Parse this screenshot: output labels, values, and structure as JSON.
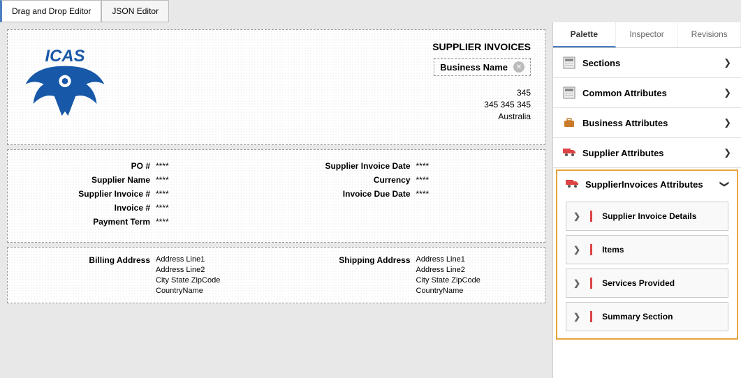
{
  "tabs": {
    "dragdrop": "Drag and Drop Editor",
    "json": "JSON Editor"
  },
  "header": {
    "title": "SUPPLIER INVOICES",
    "businessName": "Business Name",
    "addr": {
      "l1": "345",
      "l2": "345  345  345",
      "l3": "Australia"
    }
  },
  "details": {
    "left": [
      {
        "label": "PO #",
        "val": "****"
      },
      {
        "label": "Supplier Name",
        "val": "****"
      },
      {
        "label": "Supplier Invoice #",
        "val": "****"
      },
      {
        "label": "Invoice #",
        "val": "****"
      },
      {
        "label": "Payment Term",
        "val": "****"
      }
    ],
    "right": [
      {
        "label": "Supplier Invoice Date",
        "val": "****"
      },
      {
        "label": "Currency",
        "val": "****"
      },
      {
        "label": "Invoice Due Date",
        "val": "****"
      }
    ]
  },
  "addresses": {
    "billing": {
      "title": "Billing Address",
      "lines": [
        "Address Line1",
        "Address Line2",
        "City  State  ZipCode",
        "CountryName"
      ]
    },
    "shipping": {
      "title": "Shipping Address",
      "lines": [
        "Address Line1",
        "Address Line2",
        "City  State  ZipCode",
        "CountryName"
      ]
    }
  },
  "panel": {
    "tabs": {
      "palette": "Palette",
      "inspector": "Inspector",
      "revisions": "Revisions"
    },
    "groups": {
      "sections": "Sections",
      "common": "Common Attributes",
      "business": "Business Attributes",
      "supplier": "Supplier Attributes",
      "supplierInvoices": "SupplierInvoices Attributes"
    },
    "subs": {
      "sid": "Supplier Invoice Details",
      "items": "Items",
      "services": "Services Provided",
      "summary": "Summary Section"
    }
  }
}
